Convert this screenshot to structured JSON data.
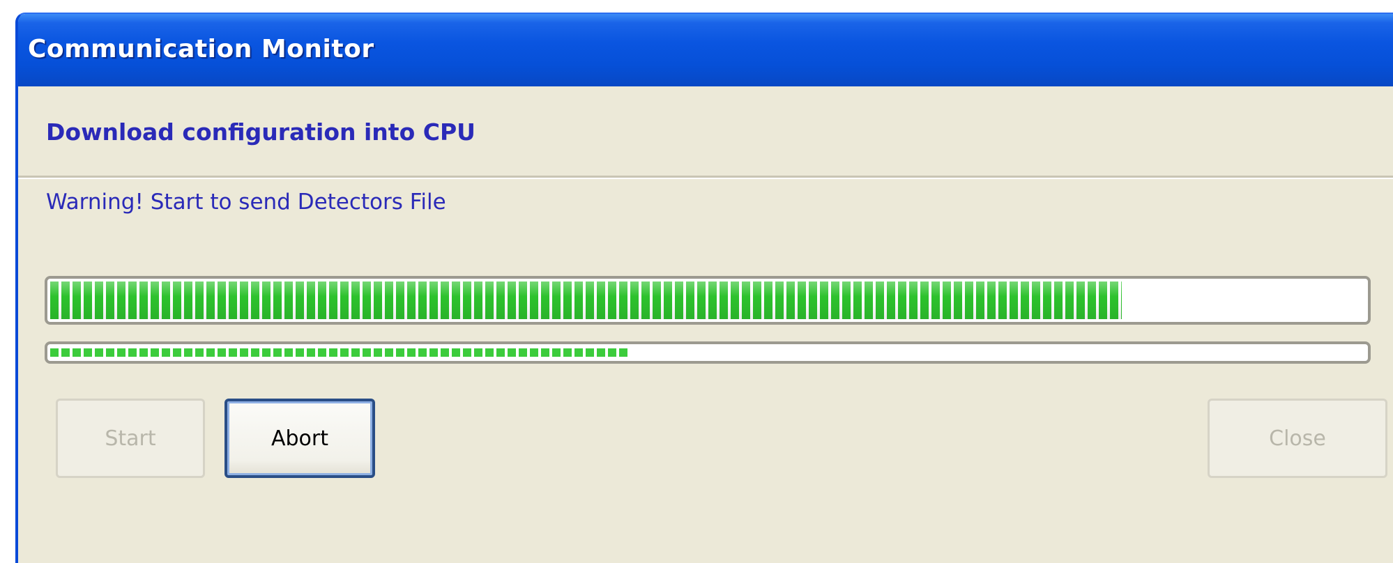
{
  "window": {
    "title": "Communication Monitor"
  },
  "header": {
    "title": "Download configuration into CPU"
  },
  "status": {
    "message": "Warning! Start to send Detectors File"
  },
  "progress": {
    "main_fraction": 0.815,
    "secondary_fraction": 0.44
  },
  "buttons": {
    "start_label": "Start",
    "abort_label": "Abort",
    "close_label": "Close",
    "start_enabled": false,
    "abort_enabled": true,
    "close_enabled": false
  },
  "colors": {
    "titlebar_blue": "#0650d8",
    "progress_green": "#2dc22d",
    "header_text": "#2a2ab8",
    "dialog_background": "#ece9d8"
  }
}
